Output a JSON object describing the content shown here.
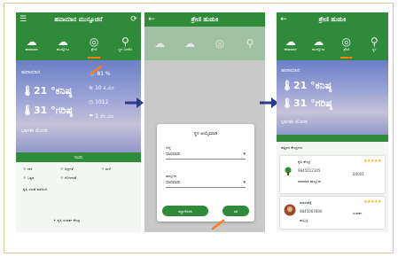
{
  "colors": {
    "brand_green": "#2f8a3a",
    "accent_orange": "#ff7a1a",
    "star": "#f2b01e"
  },
  "screen1": {
    "title": "ಹವಾಮಾನ ಮುನ್ಸೂಚನೆ",
    "tabs": [
      {
        "label": "ಹವಾಮಾನ",
        "icon": "cloud-icon"
      },
      {
        "label": "ಮುನ್ನೋಟ",
        "icon": "cloud-icon"
      },
      {
        "label": "ಶ್ರೇಣಿ",
        "icon": "target-icon"
      },
      {
        "label": "ಸ್ಥಳ ಬದಲಿಸಿ",
        "icon": "location-pin-icon"
      }
    ],
    "sky_heading": "ಹವಾಮಾನ",
    "temp_min": "21 °ಕನಿಷ್ಠ",
    "temp_max": "31 °ಗರಿಷ್ಠ",
    "condition": "ಭಾಗಶಃ ಮೋಡ",
    "stats": [
      "81 %",
      "10 ಕಿ.ಮೀ",
      "1012",
      "1 ಸೆಂ.ಮೀ"
    ],
    "bar_label": "ಇಂದು",
    "list": [
      "ಗಾಳಿ",
      "ಆರ್ದ್ರತೆ",
      "ಮಳೆ",
      "ಒತ್ತಡ",
      "ಗೋಚರತೆ",
      "ದಿಕ್ಕು"
    ],
    "footer_link": "ಕೃಷಿ ಸಲಹೆ ಪಡೆಯಿರಿ",
    "bottom_text": "ಕೃಷಿ ಸಂಪರ್ಕ ಕೇಂದ್ರ"
  },
  "screen2": {
    "title": "ಶ್ರೇಣಿ ಹುಡುಕಿ",
    "dialog_title": "ಸ್ಥಳ ಆಯ್ಕೆಮಾಡಿ",
    "field1_label": "ಜಿಲ್ಲೆ",
    "field1_value": "ಧಾರವಾಡ",
    "field2_label": "ತಾಲ್ಲೂಕು",
    "field2_value": "ಧಾರವಾಡ",
    "cancel_label": "ರದ್ದುಗೊಳಿಸಿ",
    "ok_label": "ಸರಿ"
  },
  "screen3": {
    "title": "ಶ್ರೇಣಿ ಹುಡುಕಿ",
    "tabs": [
      {
        "label": "ಹವಾಮಾನ",
        "icon": "cloud-icon"
      },
      {
        "label": "ಮುನ್ನೋಟ",
        "icon": "cloud-icon"
      },
      {
        "label": "ಶ್ರೇಣಿ",
        "icon": "target-icon"
      },
      {
        "label": "ಸ್ಥಳ",
        "icon": "location-pin-icon"
      }
    ],
    "sky_heading": "ಹವಾಮಾನ",
    "temp_min": "21 °ಕನಿಷ್ಠ",
    "temp_max": "31 °ಗರಿಷ್ಠ",
    "condition": "ಭಾಗಶಃ ಮೋಡ",
    "section_label": "ಹತ್ತಿರದ ಕೇಂದ್ರಗಳು",
    "cards": [
      {
        "name": "ಕೃಷಿ ಕೇಂದ್ರ",
        "phone": "9845012345",
        "sub": "ಧಾರವಾಡ ತಾಲ್ಲೂಕು",
        "id": "84001",
        "rating_filled": 5
      },
      {
        "name": "ಮಾರುಕಟ್ಟೆ",
        "phone": "9845067890",
        "sub": "ಹುಬ್ಬಳ್ಳಿ",
        "id": "ಸಂಪರ್ಕ",
        "rating_filled": 5
      }
    ]
  }
}
